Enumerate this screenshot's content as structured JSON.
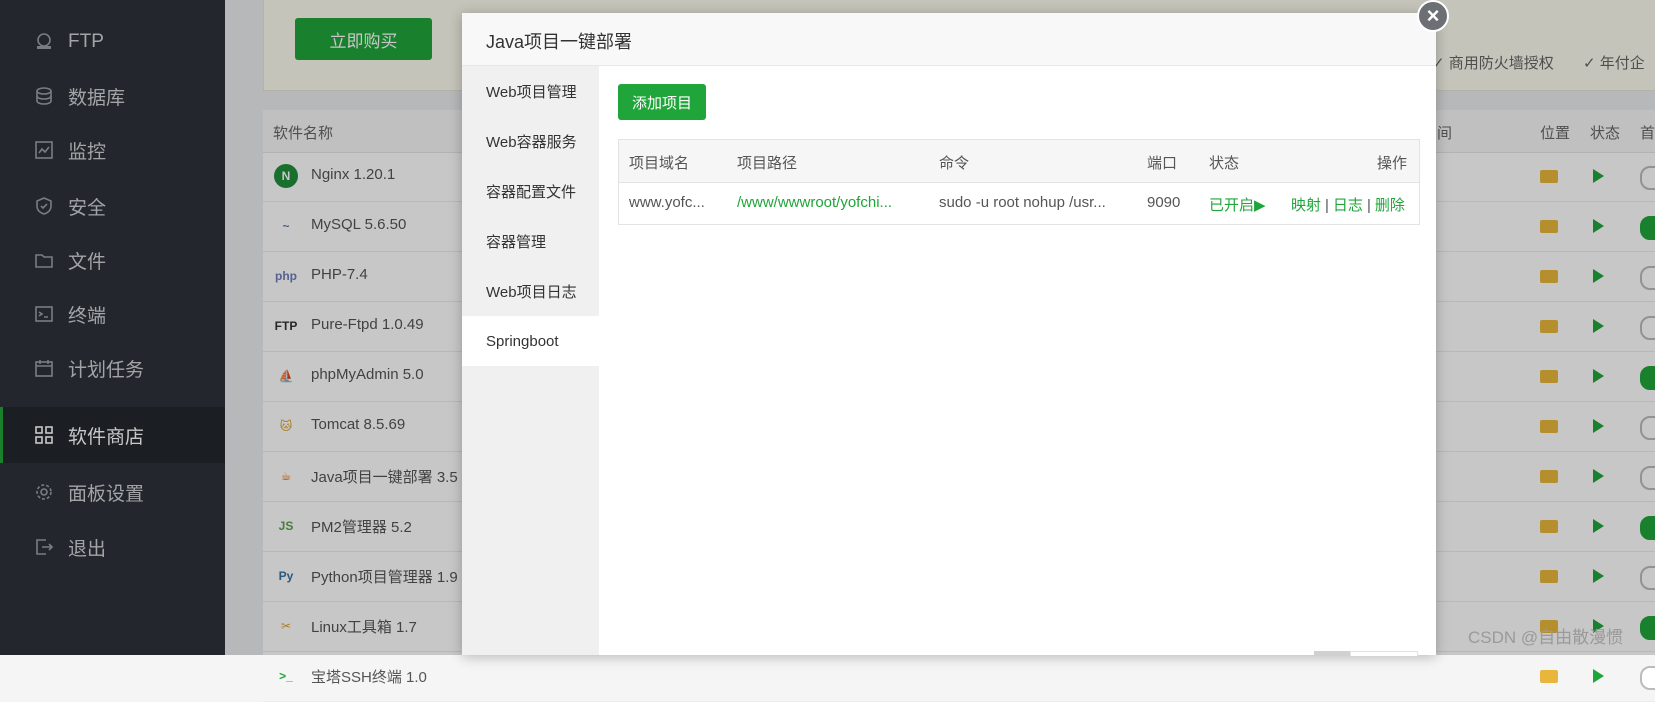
{
  "sidebar": {
    "items": [
      {
        "label": "FTP",
        "icon": "ftp-icon"
      },
      {
        "label": "数据库",
        "icon": "database-icon"
      },
      {
        "label": "监控",
        "icon": "monitor-icon"
      },
      {
        "label": "安全",
        "icon": "shield-icon"
      },
      {
        "label": "文件",
        "icon": "folder-icon"
      },
      {
        "label": "终端",
        "icon": "terminal-icon"
      },
      {
        "label": "计划任务",
        "icon": "calendar-icon"
      },
      {
        "label": "软件商店",
        "icon": "grid-icon",
        "active": true
      },
      {
        "label": "面板设置",
        "icon": "gear-icon"
      },
      {
        "label": "退出",
        "icon": "logout-icon"
      }
    ]
  },
  "background": {
    "buy_button": "立即购买",
    "top_right": [
      "商用防火墙授权",
      "年付企"
    ],
    "table_headers": {
      "name": "软件名称",
      "time": "间",
      "location": "位置",
      "status": "状态",
      "home": "首"
    },
    "software": [
      {
        "name": "Nginx 1.20.1",
        "icon": "nginx-icon",
        "on": false
      },
      {
        "name": "MySQL 5.6.50",
        "icon": "mysql-icon",
        "on": true
      },
      {
        "name": "PHP-7.4",
        "icon": "php-icon",
        "on": false
      },
      {
        "name": "Pure-Ftpd 1.0.49",
        "icon": "ftp-logo-icon",
        "on": false
      },
      {
        "name": "phpMyAdmin 5.0",
        "icon": "phpmyadmin-icon",
        "on": true
      },
      {
        "name": "Tomcat 8.5.69",
        "icon": "tomcat-icon",
        "on": false
      },
      {
        "name": "Java项目一键部署 3.5",
        "icon": "java-icon",
        "on": false
      },
      {
        "name": "PM2管理器 5.2",
        "icon": "nodejs-icon",
        "on": true
      },
      {
        "name": "Python项目管理器 1.9",
        "icon": "python-icon",
        "on": false
      },
      {
        "name": "Linux工具箱 1.7",
        "icon": "tools-icon",
        "on": true
      },
      {
        "name": "宝塔SSH终端 1.0",
        "icon": "ssh-icon",
        "on": false
      }
    ]
  },
  "modal": {
    "title": "Java项目一键部署",
    "tabs": [
      "Web项目管理",
      "Web容器服务",
      "容器配置文件",
      "容器管理",
      "Web项目日志",
      "Springboot"
    ],
    "active_tab": 5,
    "add_button": "添加项目",
    "table": {
      "headers": {
        "domain": "项目域名",
        "path": "项目路径",
        "command": "命令",
        "port": "端口",
        "status": "状态",
        "actions": "操作"
      },
      "rows": [
        {
          "domain": "www.yofc...",
          "path": "/www/wwwroot/yofchi...",
          "command": "sudo -u root nohup /usr...",
          "port": "9090",
          "status": "已开启",
          "actions": {
            "map": "映射",
            "log": "日志",
            "delete": "删除"
          }
        }
      ]
    }
  },
  "watermark": "CSDN @自由散漫惯",
  "colors": {
    "accent": "#20a53a",
    "sidebar": "#2e333a"
  }
}
